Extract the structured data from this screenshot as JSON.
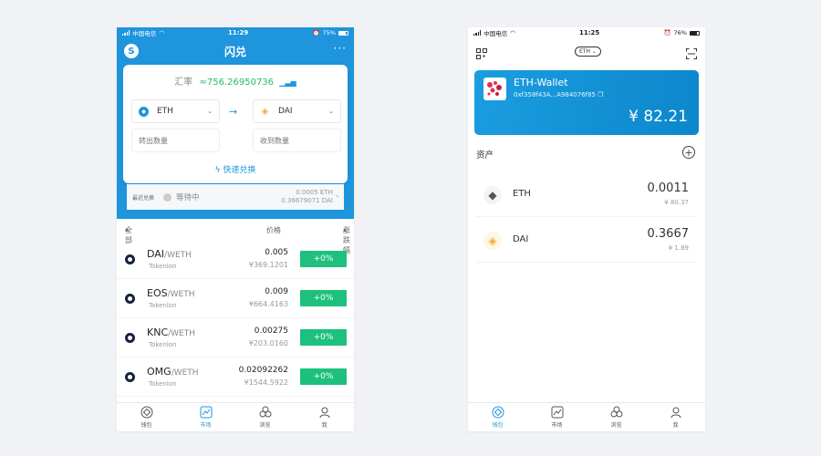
{
  "left": {
    "status": {
      "carrier": "中国电信",
      "time": "11:29",
      "battery": "75%"
    },
    "header": {
      "title": "闪兑",
      "logo_icon": "s-logo-icon",
      "more": "···"
    },
    "rate": {
      "label": "汇率",
      "value": "≈756.26950736",
      "chart_icon": "bars-icon"
    },
    "from": {
      "token": "ETH",
      "placeholder": "转出数量"
    },
    "to": {
      "token": "DAI",
      "placeholder": "收到数量"
    },
    "arrow": "→",
    "quick_label": "快速兑换",
    "recent": {
      "label": "最近兑换",
      "status": "等待中",
      "sent": "0.0005 ETH",
      "received": "0.36679071 DAI"
    },
    "list_header": {
      "all": "全部",
      "price": "价格",
      "change": "涨跌幅"
    },
    "market": [
      {
        "base": "DAI",
        "quote": "/WETH",
        "source": "Tokenlon",
        "price": "0.005",
        "cny": "¥369.1201",
        "change": "+0%"
      },
      {
        "base": "EOS",
        "quote": "/WETH",
        "source": "Tokenlon",
        "price": "0.009",
        "cny": "¥664.4163",
        "change": "+0%"
      },
      {
        "base": "KNC",
        "quote": "/WETH",
        "source": "Tokenlon",
        "price": "0.00275",
        "cny": "¥203.0160",
        "change": "+0%"
      },
      {
        "base": "OMG",
        "quote": "/WETH",
        "source": "Tokenlon",
        "price": "0.02092262",
        "cny": "¥1544.5922",
        "change": "+0%"
      }
    ],
    "tabs": [
      "钱包",
      "市场",
      "浏览",
      "我"
    ],
    "active_tab": 1
  },
  "right": {
    "status": {
      "carrier": "中国电信",
      "time": "11:25",
      "battery": "76%"
    },
    "network": "ETH",
    "wallet": {
      "name": "ETH-Wallet",
      "address": "0xf358f43A...A984076f85",
      "total": "¥ 82.21"
    },
    "assets_title": "资产",
    "assets": [
      {
        "symbol": "ETH",
        "balance": "0.0011",
        "cny": "¥ 80.37"
      },
      {
        "symbol": "DAI",
        "balance": "0.3667",
        "cny": "¥ 1.89"
      }
    ],
    "tabs": [
      "钱包",
      "市场",
      "浏览",
      "我"
    ],
    "active_tab": 0
  },
  "colors": {
    "primary": "#1e95dc",
    "positive": "#1dc07d",
    "rate": "#2ab86c",
    "dai": "#f5ac37"
  }
}
